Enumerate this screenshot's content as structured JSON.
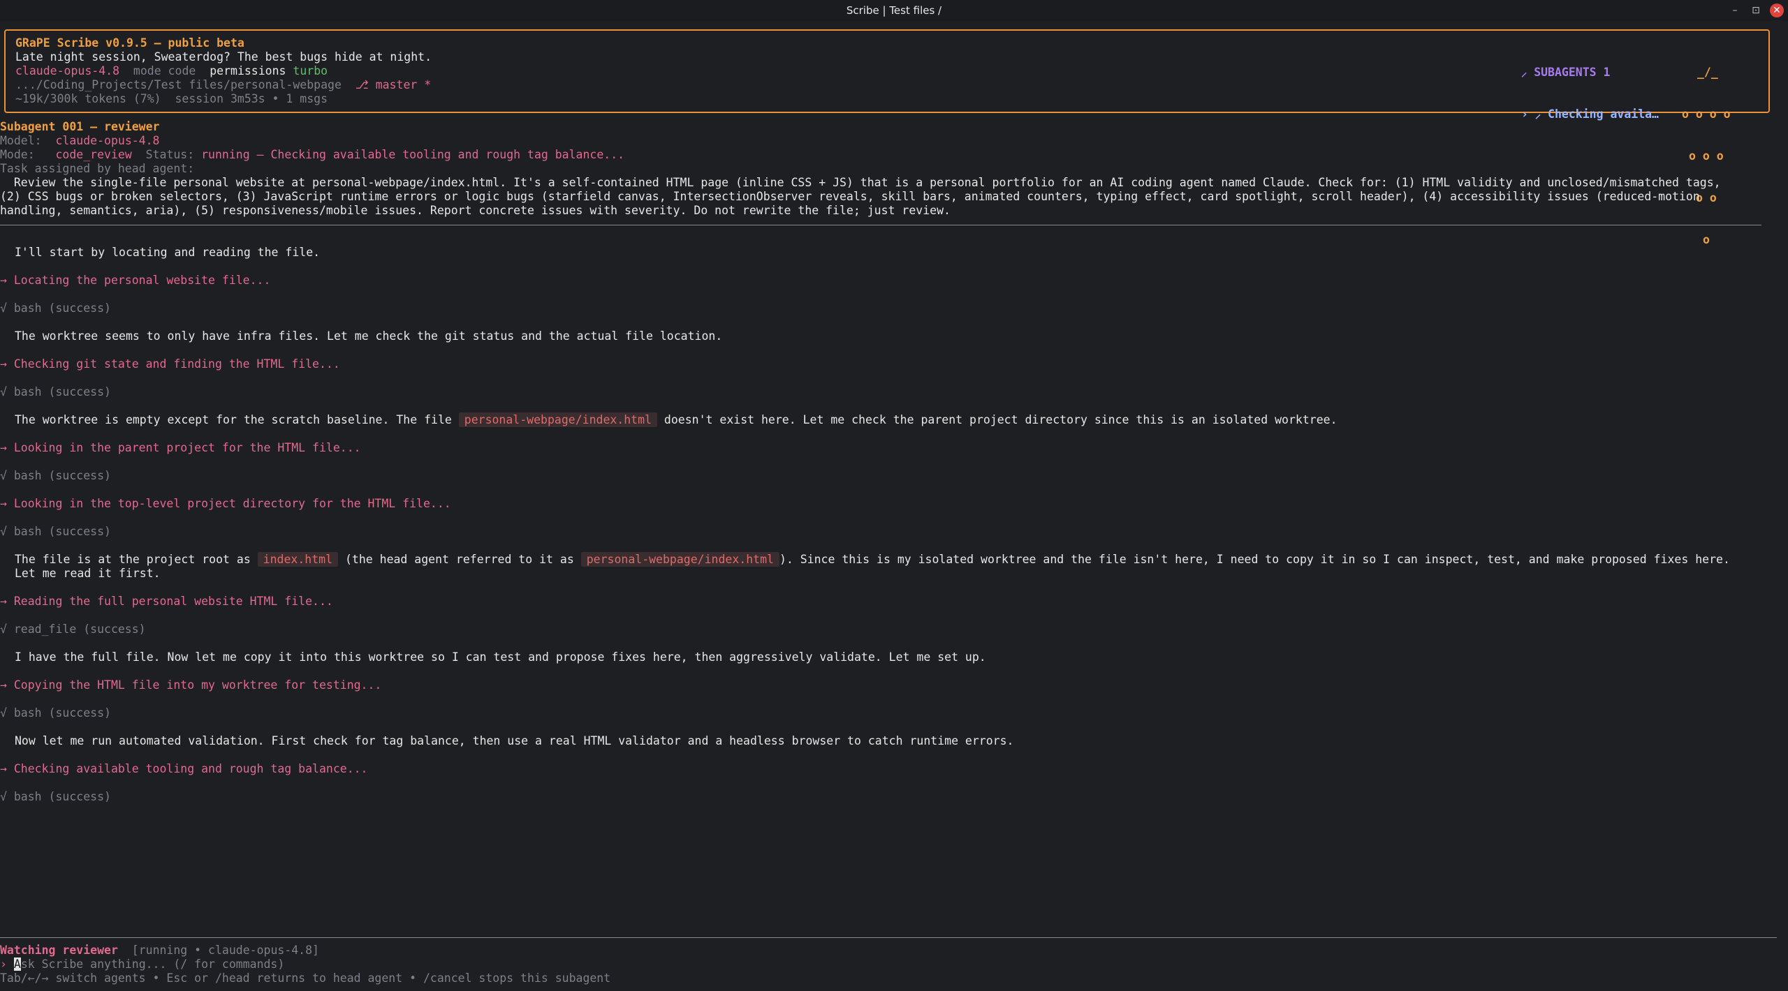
{
  "window": {
    "title": "Scribe | Test files /",
    "minimize": "–",
    "maximize": "⊡",
    "close": "✕"
  },
  "header": {
    "app_title": "GRaPE Scribe v0.9.5 – public beta",
    "greeting": "Late night session, Sweaterdog? The best bugs hide at night.",
    "model": "claude-opus-4.8",
    "mode_label": "mode",
    "mode_value": "code",
    "permissions_label": "permissions",
    "permissions_value": "turbo",
    "path": ".../Coding_Projects/Test files/personal-webpage",
    "branch": "⎇ master *",
    "stats": "~19k/300k tokens (7%)  session 3m53s • 1 msgs",
    "subagents_label": "SUBAGENTS 1",
    "subagent_status": "› ⸝ Checking availa…",
    "subagent_icon": "⸝",
    "art": [
      "_/_",
      "o o o o",
      "o o o",
      "o o",
      "o"
    ]
  },
  "subagent": {
    "title": "Subagent 001 — reviewer",
    "model_label": "Model:",
    "model_value": "claude-opus-4.8",
    "mode_label": "Mode:",
    "mode_value": "code_review",
    "status_label": "Status:",
    "status_value": "running — Checking available tooling and rough tag balance...",
    "task_label": "Task assigned by head agent:",
    "task_text": "  Review the single-file personal website at personal-webpage/index.html. It's a self-contained HTML page (inline CSS + JS) that is a personal portfolio for an AI coding agent named Claude. Check for: (1) HTML validity and unclosed/mismatched tags,\n(2) CSS bugs or broken selectors, (3) JavaScript runtime errors or logic bugs (starfield canvas, IntersectionObserver reveals, skill bars, animated counters, typing effect, card spotlight, scroll header), (4) accessibility issues (reduced-motion\nhandling, semantics, aria), (5) responsiveness/mobile issues. Report concrete issues with severity. Do not rewrite the file; just review."
  },
  "log": {
    "m1": "I'll start by locating and reading the file.",
    "a1": "→ Locating the personal website file...",
    "r1": "√ bash (success)",
    "m2": "The worktree seems to only have infra files. Let me check the git status and the actual file location.",
    "a2": "→ Checking git state and finding the HTML file...",
    "r2": "√ bash (success)",
    "m3_pre": "The worktree is empty except for the scratch baseline. The file ",
    "m3_code": "personal-webpage/index.html",
    "m3_post": " doesn't exist here. Let me check the parent project directory since this is an isolated worktree.",
    "a3": "→ Looking in the parent project for the HTML file...",
    "r3": "√ bash (success)",
    "a4": "→ Looking in the top-level project directory for the HTML file...",
    "r4": "√ bash (success)",
    "m4_pre": "The file is at the project root as ",
    "m4_code1": "index.html",
    "m4_mid": " (the head agent referred to it as ",
    "m4_code2": "personal-webpage/index.html",
    "m4_post": "). Since this is my isolated worktree and the file isn't here, I need to copy it in so I can inspect, test, and make proposed fixes here.",
    "m4_line2": "Let me read it first.",
    "a5": "→ Reading the full personal website HTML file...",
    "r5": "√ read_file (success)",
    "m5": "I have the full file. Now let me copy it into this worktree so I can test and propose fixes here, then aggressively validate. Let me set up.",
    "a6": "→ Copying the HTML file into my worktree for testing...",
    "r6": "√ bash (success)",
    "m6": "Now let me run automated validation. First check for tag balance, then use a real HTML validator and a headless browser to catch runtime errors.",
    "a7": "→ Checking available tooling and rough tag balance...",
    "r7": "√ bash (success)"
  },
  "footer": {
    "watching": "Watching reviewer",
    "watching_meta": "[running • claude-opus-4.8]",
    "prompt_symbol": "›",
    "cursor_char": "A",
    "placeholder": "sk Scribe anything... (/ for commands)",
    "hint": "Tab/←/→ switch agents • Esc or /head returns to head agent • /cancel stops this subagent"
  },
  "colors": {
    "background": "#1e1f22",
    "accent_orange": "#f0a040",
    "pink": "#e3698f",
    "purple": "#a77bf0",
    "green": "#5cc06a",
    "close_red": "#e0443e"
  }
}
